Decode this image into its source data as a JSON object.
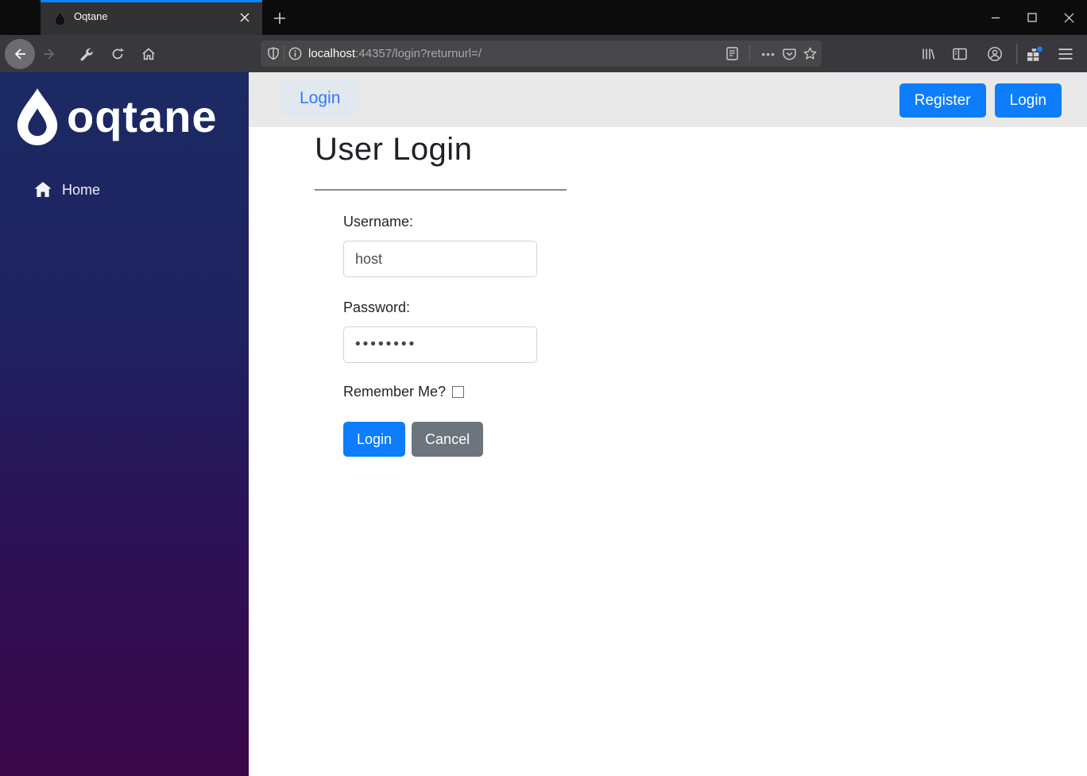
{
  "browser": {
    "tab": {
      "title": "Oqtane"
    },
    "url": {
      "host": "localhost",
      "rest": ":44357/login?returnurl=/"
    },
    "page_actions_glyph": "•••"
  },
  "sidebar": {
    "logo_text": "oqtane",
    "items": [
      {
        "label": "Home"
      }
    ]
  },
  "header": {
    "breadcrumb": "Login",
    "buttons": [
      {
        "label": "Register"
      },
      {
        "label": "Login"
      }
    ]
  },
  "main": {
    "title": "User Login",
    "form": {
      "username_label": "Username:",
      "username_value": "host",
      "password_label": "Password:",
      "password_value": "••••••••",
      "remember_label": "Remember Me?",
      "login_button": "Login",
      "cancel_button": "Cancel"
    }
  },
  "colors": {
    "accent_blue": "#0d7dfb",
    "firefox_accent": "#0a84ff",
    "sidebar_top": "#1b2a63",
    "sidebar_bottom": "#3a0748",
    "cancel_gray": "#6c757d"
  }
}
